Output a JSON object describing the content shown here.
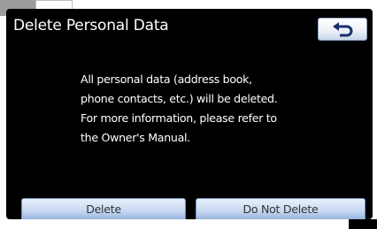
{
  "screen": {
    "title": "Delete Personal Data",
    "message_lines": [
      "All personal data (address book,",
      "phone contacts, etc.) will be deleted.",
      "For more information, please refer to",
      "the Owner's Manual."
    ]
  },
  "buttons": {
    "back_icon": "return-arrow-icon",
    "delete_label": "Delete",
    "do_not_delete_label": "Do Not Delete"
  },
  "colors": {
    "screen_background": "#000000",
    "text": "#ffffff",
    "button_blue": "#c8d9f2",
    "button_border": "#6f8fc2"
  }
}
